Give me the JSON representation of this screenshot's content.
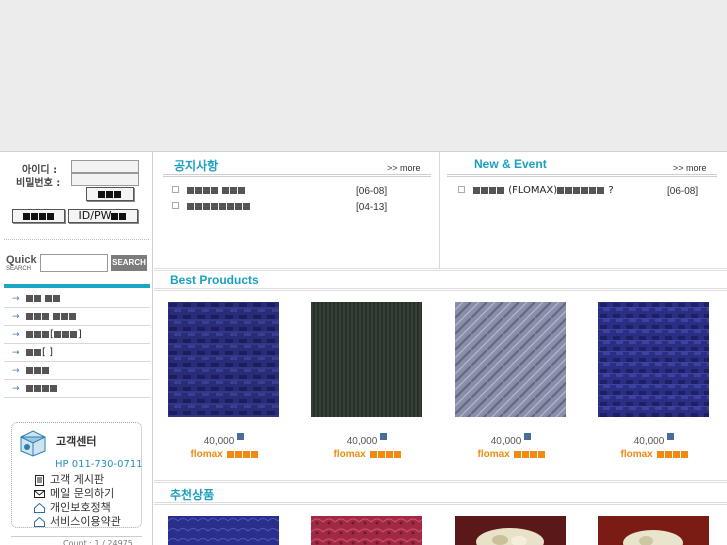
{
  "login": {
    "id_label": "아이디 :",
    "pw_label": "비밀번호 :",
    "id_pw_label": "ID/PW"
  },
  "quick_search": {
    "label_big": "Quick",
    "label_small": "SEARCH",
    "button": "SEARCH",
    "placeholder": ""
  },
  "menu": {
    "items": [
      {
        "label": "",
        "suffix": ""
      },
      {
        "label": "",
        "suffix": ""
      },
      {
        "label": "[",
        "suffix": "]"
      },
      {
        "label": "[ ]",
        "suffix": ""
      },
      {
        "label": "",
        "suffix": ""
      },
      {
        "label": "",
        "suffix": ""
      }
    ]
  },
  "customer_center": {
    "title": "고객센터",
    "phone": "HP 011-730-0711",
    "links": [
      "고객 게시판",
      "메일 문의하기",
      "개인보호정책",
      "서비스이용약관"
    ]
  },
  "counter": {
    "text": "Count : 1 / 24975"
  },
  "notice": {
    "title": "공지사항",
    "more": ">> more",
    "posts": [
      {
        "title": "",
        "date": "[06-08]"
      },
      {
        "title": "",
        "date": "[04-13]"
      }
    ]
  },
  "event": {
    "title": "New & Event",
    "more": ">> more",
    "posts": [
      {
        "title": "(FLOMAX)",
        "suffix": "?",
        "date": "[06-08]"
      }
    ]
  },
  "best_products": {
    "title": "Best Prouducts",
    "items": [
      {
        "price": "40,000",
        "brand": "flomax"
      },
      {
        "price": "40,000",
        "brand": "flomax"
      },
      {
        "price": "40,000",
        "brand": "flomax"
      },
      {
        "price": "40,000",
        "brand": "flomax"
      }
    ]
  },
  "recommended": {
    "title": "추천상품"
  },
  "colors": {
    "accent": "#1aa7c4",
    "brand_orange": "#f08a12",
    "background": "#ececec"
  }
}
